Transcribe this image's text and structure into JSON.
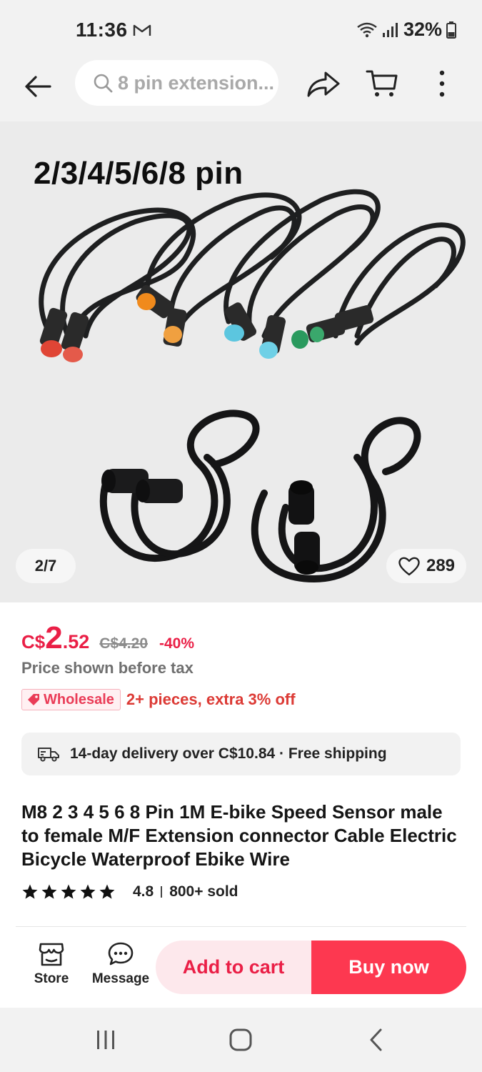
{
  "status_bar": {
    "time": "11:36",
    "battery": "32%"
  },
  "header": {
    "search_query": "8 pin extension..."
  },
  "gallery": {
    "caption": "2/3/4/5/6/8 pin",
    "page_indicator": "2/7",
    "wishlist_count": "289"
  },
  "price": {
    "currency": "C$",
    "integer": "2",
    "decimal": ".52",
    "original": "C$4.20",
    "discount": "-40%",
    "tax_note": "Price shown before tax"
  },
  "wholesale": {
    "tag": "Wholesale",
    "offer": "2+ pieces, extra 3% off"
  },
  "delivery": {
    "text": "14-day delivery over C$10.84 · Free shipping"
  },
  "product": {
    "title": "M8 2 3 4 5 6 8 Pin 1M E-bike Speed Sensor male to female M/F Extension connector Cable Electric Bicycle Waterproof Ebike Wire",
    "rating": "4.8",
    "stars": 5,
    "sold": "800+ sold"
  },
  "action_bar": {
    "store_label": "Store",
    "message_label": "Message",
    "add_to_cart_label": "Add to cart",
    "buy_now_label": "Buy now"
  },
  "colors": {
    "accent": "#ea1f46",
    "buy_button": "#fd3850",
    "cart_button_bg": "#fde8ec",
    "connector_red": "#e04535",
    "connector_orange": "#f08a1c",
    "connector_blue": "#5cc6df",
    "connector_green": "#2a9a5e"
  }
}
